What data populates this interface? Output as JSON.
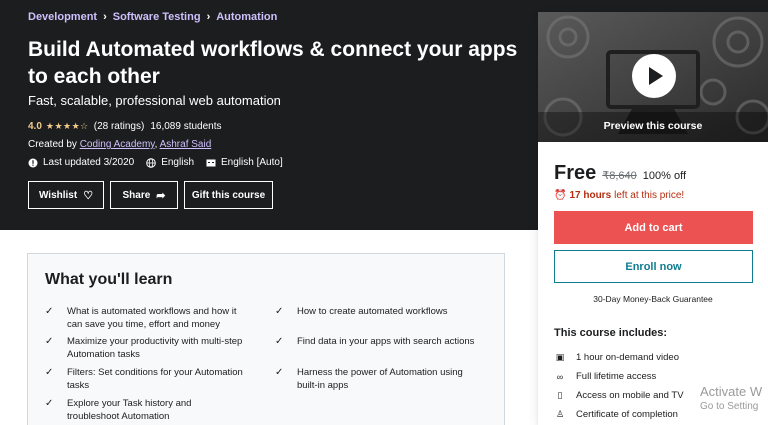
{
  "breadcrumb": [
    "Development",
    "Software Testing",
    "Automation"
  ],
  "course": {
    "title": "Build Automated workflows & connect your apps to each other",
    "subtitle": "Fast, scalable, professional web automation",
    "rating": "4.0",
    "ratings_count": "(28 ratings)",
    "students": "16,089 students",
    "created_by_label": "Created by",
    "authors": [
      "Coding Academy",
      "Ashraf Said"
    ],
    "author_sep": ",",
    "last_updated": "Last updated 3/2020",
    "language": "English",
    "captions": "English [Auto]"
  },
  "actions": {
    "wishlist": "Wishlist",
    "share": "Share",
    "gift": "Gift this course"
  },
  "sidebar": {
    "preview_label": "Preview this course",
    "price_now": "Free",
    "price_old": "₹8,640",
    "discount": "100% off",
    "timer_hours": "17 hours",
    "timer_suffix": "left at this price!",
    "add_to_cart": "Add to cart",
    "enroll": "Enroll now",
    "guarantee": "30-Day Money-Back Guarantee",
    "includes_title": "This course includes:",
    "includes": [
      {
        "icon": "video-icon",
        "label": "1 hour on-demand video"
      },
      {
        "icon": "infinity-icon",
        "label": "Full lifetime access"
      },
      {
        "icon": "mobile-icon",
        "label": "Access on mobile and TV"
      },
      {
        "icon": "certificate-icon",
        "label": "Certificate of completion"
      }
    ]
  },
  "learn": {
    "title": "What you'll learn",
    "items": [
      "What is automated workflows and how it can save you time, effort and money",
      "How to create automated workflows",
      "Maximize your productivity with multi-step Automation tasks",
      "Find data in your apps with search actions",
      "Filters: Set conditions for your Automation tasks",
      "Harness the power of Automation using built-in apps",
      "Explore your Task history and troubleshoot Automation"
    ]
  },
  "watermark": {
    "line1": "Activate W",
    "line2": "Go to Setting"
  },
  "colors": {
    "hero_bg": "#1c1d1f",
    "link_purple": "#cec0fc",
    "star_gold": "#f3ca8c",
    "cart_red": "#ec5252",
    "enroll_teal": "#0f7c90",
    "timer_red": "#b32d0f"
  }
}
